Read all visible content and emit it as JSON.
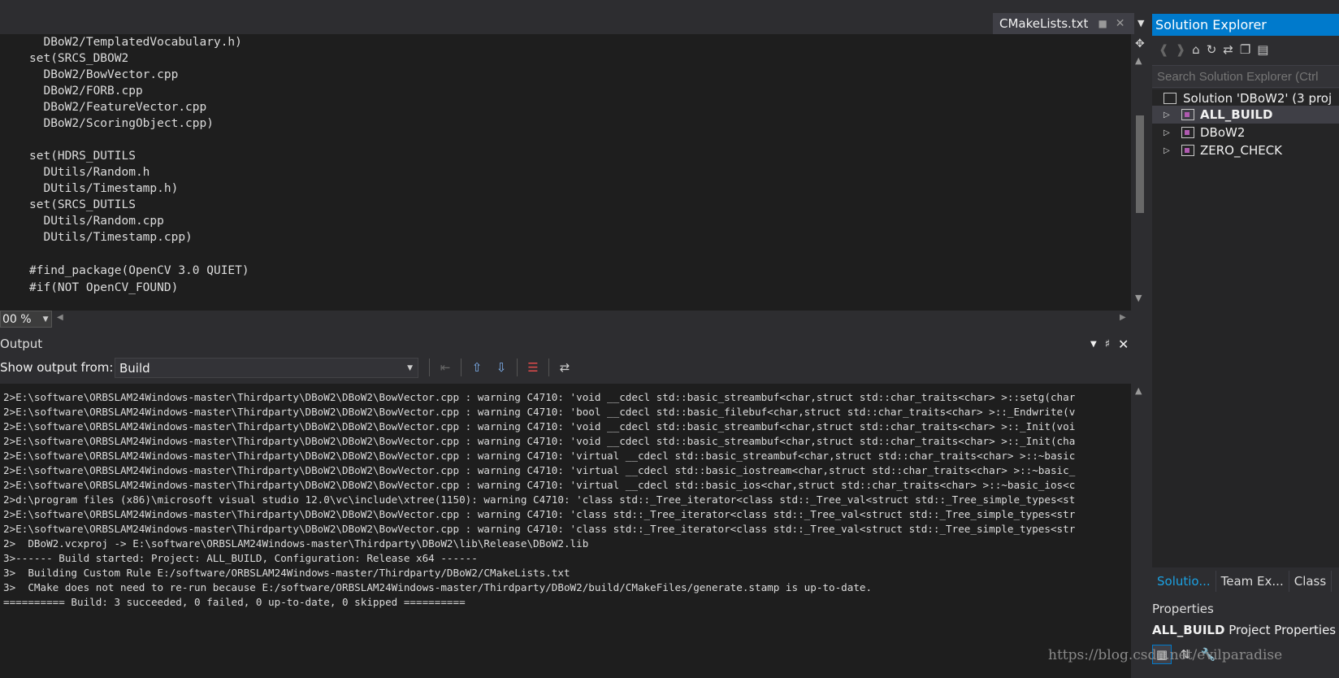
{
  "editor": {
    "tab_label": "CMakeLists.txt",
    "lines": [
      "  DBoW2/TemplatedVocabulary.h)",
      "set(SRCS_DBOW2",
      "  DBoW2/BowVector.cpp",
      "  DBoW2/FORB.cpp",
      "  DBoW2/FeatureVector.cpp",
      "  DBoW2/ScoringObject.cpp)",
      "",
      "set(HDRS_DUTILS",
      "  DUtils/Random.h",
      "  DUtils/Timestamp.h)",
      "set(SRCS_DUTILS",
      "  DUtils/Random.cpp",
      "  DUtils/Timestamp.cpp)",
      "",
      "#find_package(OpenCV 3.0 QUIET)",
      "#if(NOT OpenCV_FOUND)"
    ],
    "zoom": "00 %"
  },
  "output": {
    "title": "Output",
    "show_from_label": "Show output from:",
    "source": "Build",
    "lines": [
      "2>E:\\software\\ORBSLAM24Windows-master\\Thirdparty\\DBoW2\\DBoW2\\BowVector.cpp : warning C4710: 'void __cdecl std::basic_streambuf<char,struct std::char_traits<char> >::setg(char",
      "2>E:\\software\\ORBSLAM24Windows-master\\Thirdparty\\DBoW2\\DBoW2\\BowVector.cpp : warning C4710: 'bool __cdecl std::basic_filebuf<char,struct std::char_traits<char> >::_Endwrite(v",
      "2>E:\\software\\ORBSLAM24Windows-master\\Thirdparty\\DBoW2\\DBoW2\\BowVector.cpp : warning C4710: 'void __cdecl std::basic_streambuf<char,struct std::char_traits<char> >::_Init(voi",
      "2>E:\\software\\ORBSLAM24Windows-master\\Thirdparty\\DBoW2\\DBoW2\\BowVector.cpp : warning C4710: 'void __cdecl std::basic_streambuf<char,struct std::char_traits<char> >::_Init(cha",
      "2>E:\\software\\ORBSLAM24Windows-master\\Thirdparty\\DBoW2\\DBoW2\\BowVector.cpp : warning C4710: 'virtual __cdecl std::basic_streambuf<char,struct std::char_traits<char> >::~basic",
      "2>E:\\software\\ORBSLAM24Windows-master\\Thirdparty\\DBoW2\\DBoW2\\BowVector.cpp : warning C4710: 'virtual __cdecl std::basic_iostream<char,struct std::char_traits<char> >::~basic_",
      "2>E:\\software\\ORBSLAM24Windows-master\\Thirdparty\\DBoW2\\DBoW2\\BowVector.cpp : warning C4710: 'virtual __cdecl std::basic_ios<char,struct std::char_traits<char> >::~basic_ios<c",
      "2>d:\\program files (x86)\\microsoft visual studio 12.0\\vc\\include\\xtree(1150): warning C4710: 'class std::_Tree_iterator<class std::_Tree_val<struct std::_Tree_simple_types<st",
      "2>E:\\software\\ORBSLAM24Windows-master\\Thirdparty\\DBoW2\\DBoW2\\BowVector.cpp : warning C4710: 'class std::_Tree_iterator<class std::_Tree_val<struct std::_Tree_simple_types<str",
      "2>E:\\software\\ORBSLAM24Windows-master\\Thirdparty\\DBoW2\\DBoW2\\BowVector.cpp : warning C4710: 'class std::_Tree_iterator<class std::_Tree_val<struct std::_Tree_simple_types<str",
      "2>  DBoW2.vcxproj -> E:\\software\\ORBSLAM24Windows-master\\Thirdparty\\DBoW2\\lib\\Release\\DBoW2.lib",
      "3>------ Build started: Project: ALL_BUILD, Configuration: Release x64 ------",
      "3>  Building Custom Rule E:/software/ORBSLAM24Windows-master/Thirdparty/DBoW2/CMakeLists.txt",
      "3>  CMake does not need to re-run because E:/software/ORBSLAM24Windows-master/Thirdparty/DBoW2/build/CMakeFiles/generate.stamp is up-to-date.",
      "========== Build: 3 succeeded, 0 failed, 0 up-to-date, 0 skipped =========="
    ]
  },
  "solution_explorer": {
    "title": "Solution Explorer",
    "search_placeholder": "Search Solution Explorer (Ctrl",
    "solution_label": "Solution 'DBoW2' (3 proj",
    "projects": [
      "ALL_BUILD",
      "DBoW2",
      "ZERO_CHECK"
    ],
    "tabs": [
      "Solutio...",
      "Team Ex...",
      "Class"
    ]
  },
  "properties": {
    "title": "Properties",
    "object": "ALL_BUILD",
    "object_type": "Project Properties"
  },
  "watermark": "https://blog.csdn.net/evilparadise",
  "colors": {
    "accent": "#007acc",
    "editor_bg": "#1e1e1e",
    "chrome_bg": "#2d2d30"
  }
}
